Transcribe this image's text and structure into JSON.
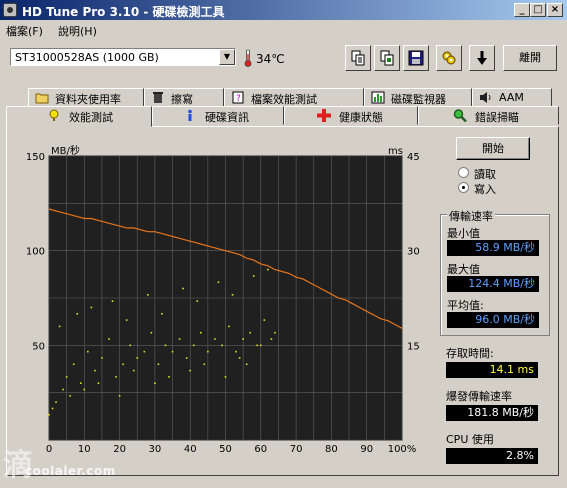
{
  "window": {
    "title": "HD Tune Pro 3.10 - 硬碟檢測工具",
    "minimize_glyph": "_",
    "maximize_glyph": "□",
    "close_glyph": "×"
  },
  "menu": [
    {
      "label": "檔案(F)"
    },
    {
      "label": "說明(H)"
    }
  ],
  "toolbar": {
    "drive": "ST31000528AS (1000 GB)",
    "temperature": "34℃",
    "buttons": [
      {
        "icon": "copy-info-icon"
      },
      {
        "icon": "copy-screen-icon"
      },
      {
        "icon": "save-icon"
      },
      {
        "icon": "options-icon"
      },
      {
        "icon": "download-icon"
      }
    ],
    "exit_label": "離開"
  },
  "tabs_top": [
    {
      "label": "資料夾使用率",
      "icon": "folder-icon"
    },
    {
      "label": "擦寫",
      "icon": "trash-icon"
    },
    {
      "label": "檔案效能測試",
      "icon": "file-test-icon"
    },
    {
      "label": "磁碟監視器",
      "icon": "disk-monitor-icon"
    },
    {
      "label": "AAM",
      "icon": "speaker-icon"
    }
  ],
  "tabs_bottom": [
    {
      "label": "效能測試",
      "icon": "benchmark-icon",
      "active": true
    },
    {
      "label": "硬碟資訊",
      "icon": "info-icon"
    },
    {
      "label": "健康狀態",
      "icon": "health-icon"
    },
    {
      "label": "錯誤掃瞄",
      "icon": "error-scan-icon"
    }
  ],
  "controls": {
    "start_label": "開始",
    "read_label": "讀取",
    "write_label": "寫入",
    "selected_mode": "write"
  },
  "stats": {
    "transfer_title": "傳輸速率",
    "min_label": "最小值",
    "min_value": "58.9 MB/秒",
    "max_label": "最大值",
    "max_value": "124.4 MB/秒",
    "avg_label": "平均值:",
    "avg_value": "96.0 MB/秒",
    "access_label": "存取時間:",
    "access_value": "14.1 ms",
    "burst_label": "爆發傳輸速率",
    "burst_value": "181.8 MB/秒",
    "cpu_label": "CPU 使用",
    "cpu_value": "2.8%"
  },
  "colors": {
    "transfer_line": "#e8741a",
    "access_points": "#e0e020",
    "chart_bg": "#202020",
    "grid": "#606060",
    "value_blue": "#5aa0ff",
    "value_yellow": "#ffff40"
  },
  "watermark": {
    "glyph": "滴",
    "text": "coolaler.com"
  },
  "chart_data": {
    "type": "line",
    "ylabel_left": "MB/秒",
    "ylabel_right": "ms",
    "x_ticks": [
      "0",
      "10",
      "20",
      "30",
      "40",
      "50",
      "60",
      "70",
      "80",
      "90",
      "100%"
    ],
    "y_left_ticks": [
      "150",
      "100",
      "50"
    ],
    "y_right_ticks": [
      "45",
      "30",
      "15"
    ],
    "xlim": [
      0,
      100
    ],
    "ylim_left": [
      0,
      150
    ],
    "ylim_right": [
      0,
      45
    ],
    "grid": true,
    "transfer_series": {
      "x": [
        0,
        2,
        4,
        6,
        8,
        10,
        12,
        14,
        16,
        18,
        20,
        22,
        24,
        26,
        28,
        30,
        32,
        34,
        36,
        38,
        40,
        42,
        44,
        46,
        48,
        50,
        52,
        54,
        56,
        58,
        60,
        62,
        64,
        66,
        68,
        70,
        72,
        74,
        76,
        78,
        80,
        82,
        84,
        86,
        88,
        90,
        92,
        94,
        96,
        98,
        100
      ],
      "y": [
        122,
        121,
        120,
        119,
        118,
        117,
        117,
        116,
        115,
        114,
        113,
        112,
        112,
        111,
        110,
        110,
        109,
        108,
        107,
        106,
        105,
        104,
        103,
        102,
        101,
        100,
        99,
        98,
        96,
        95,
        93,
        92,
        90,
        89,
        88,
        86,
        85,
        83,
        81,
        79,
        77,
        75,
        74,
        72,
        70,
        68,
        66,
        64,
        63,
        61,
        59
      ]
    },
    "access_series": {
      "x": [
        0,
        2,
        4,
        5,
        7,
        9,
        11,
        13,
        15,
        17,
        19,
        21,
        23,
        25,
        27,
        29,
        31,
        33,
        35,
        37,
        39,
        41,
        43,
        45,
        47,
        49,
        51,
        53,
        55,
        57,
        59,
        61,
        63,
        64,
        3,
        8,
        12,
        18,
        22,
        28,
        32,
        38,
        42,
        48,
        52,
        58,
        62,
        6,
        14,
        24,
        34,
        44,
        54,
        60,
        1,
        10,
        20,
        30,
        40,
        50,
        56
      ],
      "y": [
        4,
        6,
        8,
        10,
        12,
        9,
        14,
        11,
        13,
        16,
        10,
        12,
        15,
        13,
        14,
        17,
        12,
        15,
        14,
        16,
        13,
        15,
        17,
        14,
        16,
        15,
        18,
        14,
        16,
        17,
        15,
        19,
        16,
        17,
        18,
        20,
        21,
        22,
        19,
        23,
        20,
        24,
        22,
        25,
        23,
        26,
        27,
        7,
        9,
        11,
        10,
        12,
        13,
        15,
        5,
        8,
        7,
        9,
        11,
        10,
        12
      ]
    }
  }
}
